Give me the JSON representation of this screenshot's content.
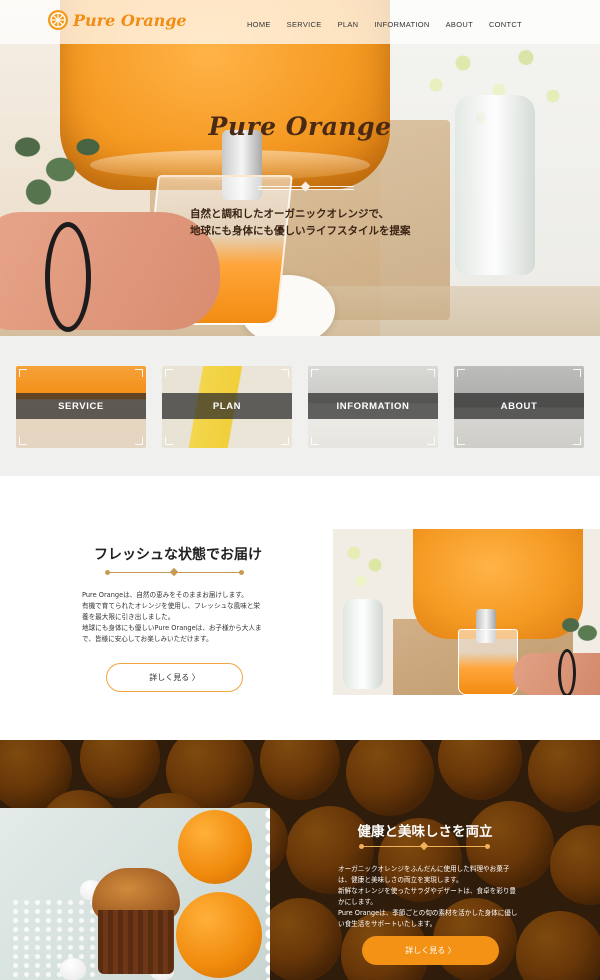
{
  "header": {
    "logo_text": "Pure Orange",
    "nav": [
      "HOME",
      "SERVICE",
      "PLAN",
      "INFORMATION",
      "ABOUT",
      "CONTCT"
    ]
  },
  "hero": {
    "title": "Pure Orange",
    "copy_line1": "自然と調和したオーガニックオレンジで、",
    "copy_line2": "地球にも身体にも優しいライフスタイルを提案"
  },
  "tiles": [
    {
      "label": "SERVICE"
    },
    {
      "label": "PLAN"
    },
    {
      "label": "INFORMATION"
    },
    {
      "label": "ABOUT"
    }
  ],
  "fresh": {
    "title": "フレッシュな状態でお届け",
    "body_lines": [
      "Pure Orangeは、自然の恵みをそのままお届けします。",
      "有機で育てられたオレンジを使用し、フレッシュな風味と栄",
      "養を最大限に引き出しました。",
      "地球にも身体にも優しいPure Orangeは、お子様から大人ま",
      "で、皆様に安心してお楽しみいただけます。"
    ],
    "button_label": "詳しく見る 〉"
  },
  "health": {
    "title": "健康と美味しさを両立",
    "body_lines": [
      "オーガニックオレンジをふんだんに使用した料理やお菓子",
      "は、健康と美味しさの両立を実現します。",
      "新鮮なオレンジを使ったサラダやデザートは、食卓を彩り豊",
      "かにします。",
      "Pure Orangeは、季節ごとの旬の素材を活かした身体に優し",
      "い食生活をサポートいたします。"
    ],
    "button_label": "詳しく見る 〉"
  },
  "colors": {
    "accent": "#f39214",
    "gold": "#c79a52",
    "dark_band": "#3a2410"
  }
}
